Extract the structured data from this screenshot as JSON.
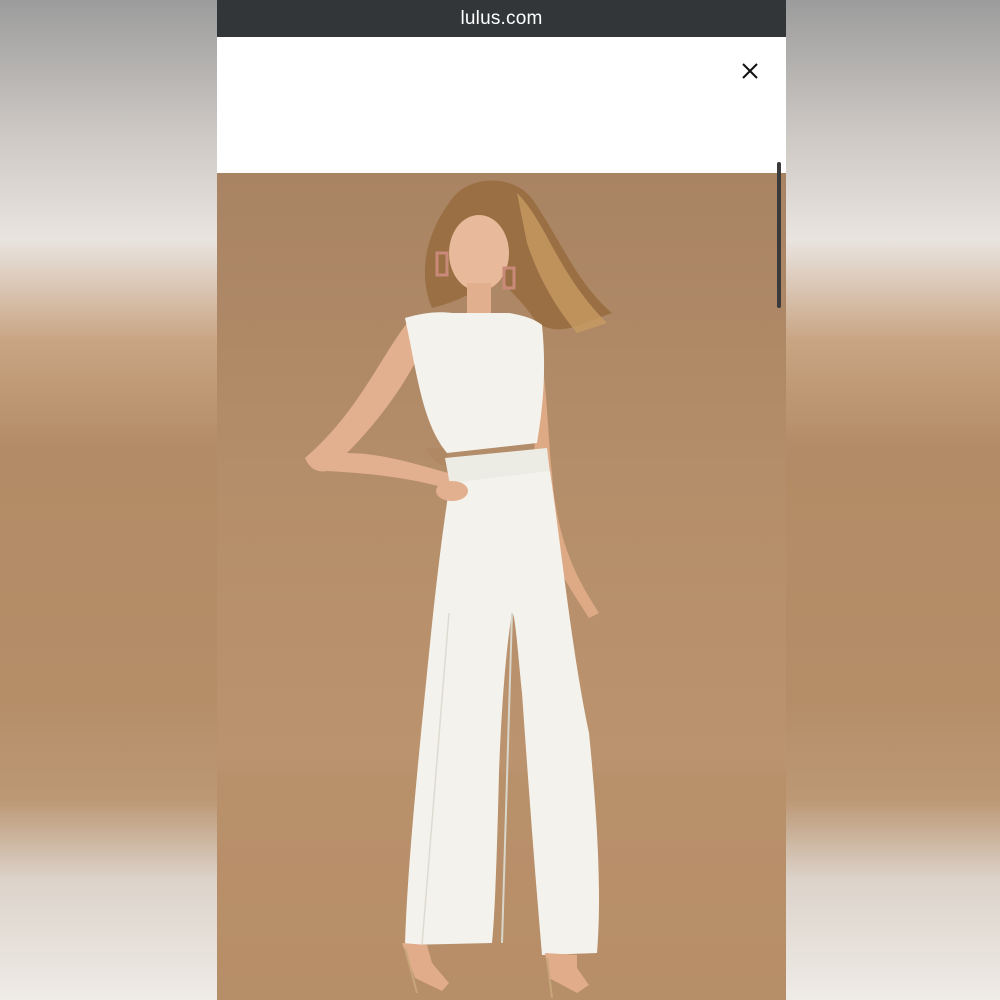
{
  "browser": {
    "url": "lulus.com"
  },
  "modal": {
    "close_icon": "close-icon"
  },
  "product_image": {
    "description_icon": "product-photo",
    "background_color": "#b58e6a",
    "garment_color": "#f4f2ec"
  },
  "colors": {
    "url_bar": "#323639",
    "url_text": "#ffffff",
    "header_bg": "#ffffff",
    "scrollbar": "#3a3a3a"
  }
}
